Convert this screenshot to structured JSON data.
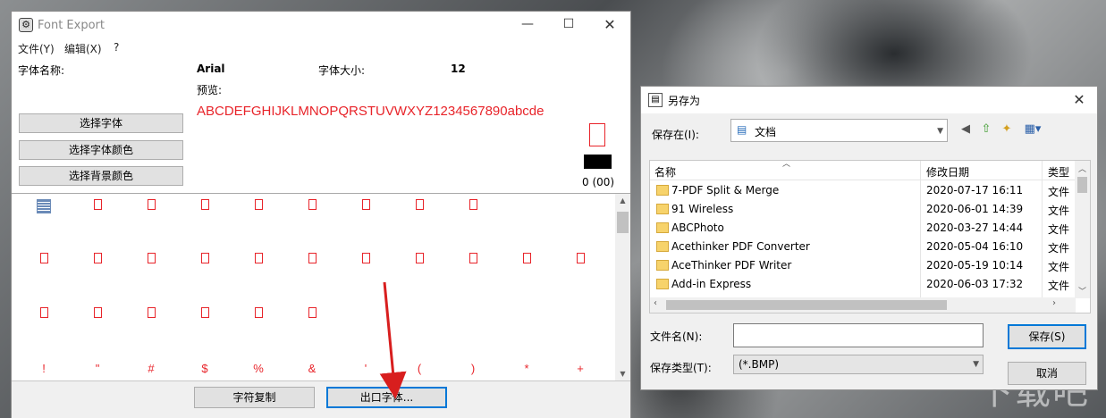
{
  "font_export": {
    "title": "Font Export",
    "menu": [
      "文件(Y)",
      "编辑(X)",
      "?"
    ],
    "font_name_label": "字体名称:",
    "font_name_value": "Arial",
    "font_size_label": "字体大小:",
    "font_size_value": "12",
    "preview_label": "预览:",
    "preview_text": "ABCDEFGHIJKLMNOPQRSTUVWXYZ1234567890abcde",
    "buttons": {
      "select_font": "选择字体",
      "select_font_color": "选择字体颜色",
      "select_bg_color": "选择背景颜色",
      "copy_char": "字符复制",
      "export_font": "出口字体..."
    },
    "char_code": "0 (00)",
    "grid_rows": [
      [
        "",
        "",
        "",
        "",
        "",
        "",
        "",
        "",
        ""
      ],
      [
        "",
        "",
        "",
        "",
        "",
        "",
        "",
        "",
        "",
        "",
        ""
      ],
      [
        "",
        "",
        "",
        "",
        "",
        ""
      ],
      [
        "!",
        "\"",
        "#",
        "$",
        "%",
        "&",
        "'",
        "(",
        ")",
        "*",
        "+"
      ]
    ],
    "colors": {
      "glyph": "#e8242a",
      "swatch": "#000000"
    }
  },
  "save_as": {
    "title": "另存为",
    "save_in_label": "保存在(I):",
    "save_in_value": "文档",
    "columns": {
      "name": "名称",
      "date": "修改日期",
      "type": "类型"
    },
    "files": [
      {
        "name": "7-PDF Split & Merge",
        "date": "2020-07-17 16:11",
        "type": "文件"
      },
      {
        "name": "91 Wireless",
        "date": "2020-06-01 14:39",
        "type": "文件"
      },
      {
        "name": "ABCPhoto",
        "date": "2020-03-27 14:44",
        "type": "文件"
      },
      {
        "name": "Acethinker PDF Converter",
        "date": "2020-05-04 16:10",
        "type": "文件"
      },
      {
        "name": "AceThinker PDF Writer",
        "date": "2020-05-19 10:14",
        "type": "文件"
      },
      {
        "name": "Add-in Express",
        "date": "2020-06-03 17:32",
        "type": "文件"
      }
    ],
    "filename_label": "文件名(N):",
    "filename_value": "",
    "filetype_label": "保存类型(T):",
    "filetype_value": "(*.BMP)",
    "save_button": "保存(S)",
    "cancel_button": "取消"
  },
  "watermark": "下载吧",
  "icons": [
    "app-icon",
    "minimize-icon",
    "maximize-icon",
    "close-icon",
    "document-icon",
    "back-icon",
    "up-folder-icon",
    "new-folder-icon",
    "view-menu-icon",
    "folder-icon",
    "sort-arrow-icon"
  ]
}
